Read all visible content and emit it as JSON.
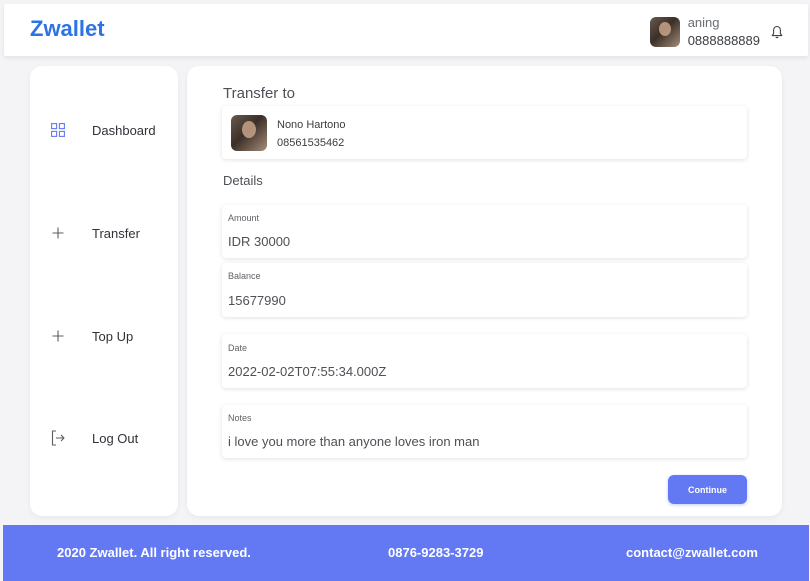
{
  "header": {
    "brand": "Zwallet",
    "user": {
      "name": "aning",
      "phone": "0888888889"
    },
    "icons": {
      "bell": "bell-icon",
      "avatar": "profile-photo"
    }
  },
  "sidebar": {
    "items": [
      {
        "label": "Dashboard",
        "icon": "grid-icon"
      },
      {
        "label": "Transfer",
        "icon": "plus-icon"
      },
      {
        "label": "Top Up",
        "icon": "plus-icon"
      },
      {
        "label": "Log Out",
        "icon": "logout-icon"
      }
    ]
  },
  "main": {
    "transfer_to_title": "Transfer to",
    "recipient": {
      "name": "Nono Hartono",
      "phone": "08561535462"
    },
    "details_title": "Details",
    "fields": {
      "amount": {
        "label": "Amount",
        "value": "IDR 30000"
      },
      "balance": {
        "label": "Balance",
        "value": "15677990"
      },
      "date": {
        "label": "Date",
        "value": "2022-02-02T07:55:34.000Z"
      },
      "notes": {
        "label": "Notes",
        "value": "i love you more than anyone loves iron man"
      }
    },
    "continue_label": "Continue"
  },
  "footer": {
    "copyright": "2020 Zwallet. All right reserved.",
    "phone": "0876-9283-3729",
    "email": "contact@zwallet.com"
  },
  "colors": {
    "brand": "#2d73e6",
    "accent": "#6379f4",
    "background": "#f4f4f6"
  }
}
